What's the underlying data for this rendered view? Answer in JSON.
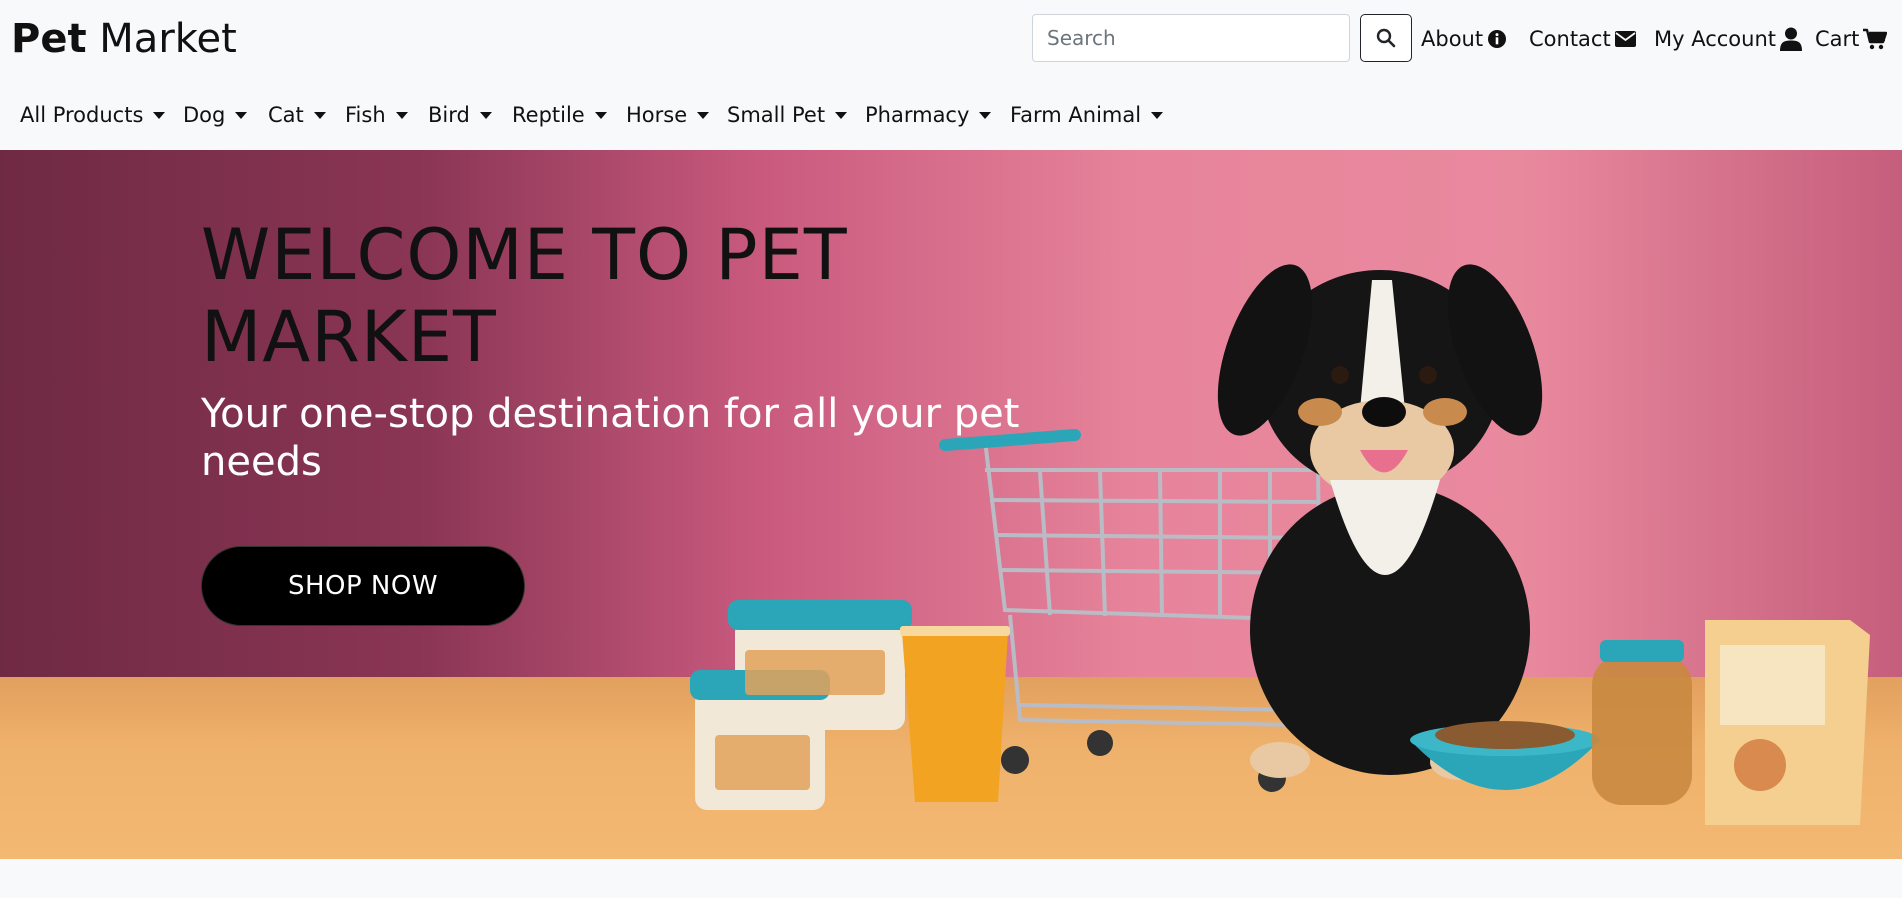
{
  "brand": {
    "bold": "Pet",
    "light": "Market"
  },
  "search": {
    "placeholder": "Search"
  },
  "util_links": [
    {
      "label": "About",
      "icon": "info-circle-icon"
    },
    {
      "label": "Contact",
      "icon": "envelope-icon"
    },
    {
      "label": "My Account",
      "icon": "user-icon"
    },
    {
      "label": "Cart",
      "icon": "cart-icon"
    }
  ],
  "nav": [
    {
      "label": "All Products"
    },
    {
      "label": "Dog"
    },
    {
      "label": "Cat"
    },
    {
      "label": "Fish"
    },
    {
      "label": "Bird"
    },
    {
      "label": "Reptile"
    },
    {
      "label": "Horse"
    },
    {
      "label": "Small Pet"
    },
    {
      "label": "Pharmacy"
    },
    {
      "label": "Farm Animal"
    }
  ],
  "hero": {
    "title": "WELCOME TO PET MARKET",
    "subtitle": "Your one-stop destination for all your pet needs",
    "button_label": "SHOP NOW",
    "image_alt": "dog-with-shopping-cart-and-pet-food"
  },
  "colors": {
    "page_bg": "#f8f9fa",
    "hero_pink": "#e7849b",
    "hero_dark": "#6f2a43",
    "floor": "#efb26c",
    "accent_teal": "#2aa6b8",
    "button_bg": "#000000"
  }
}
